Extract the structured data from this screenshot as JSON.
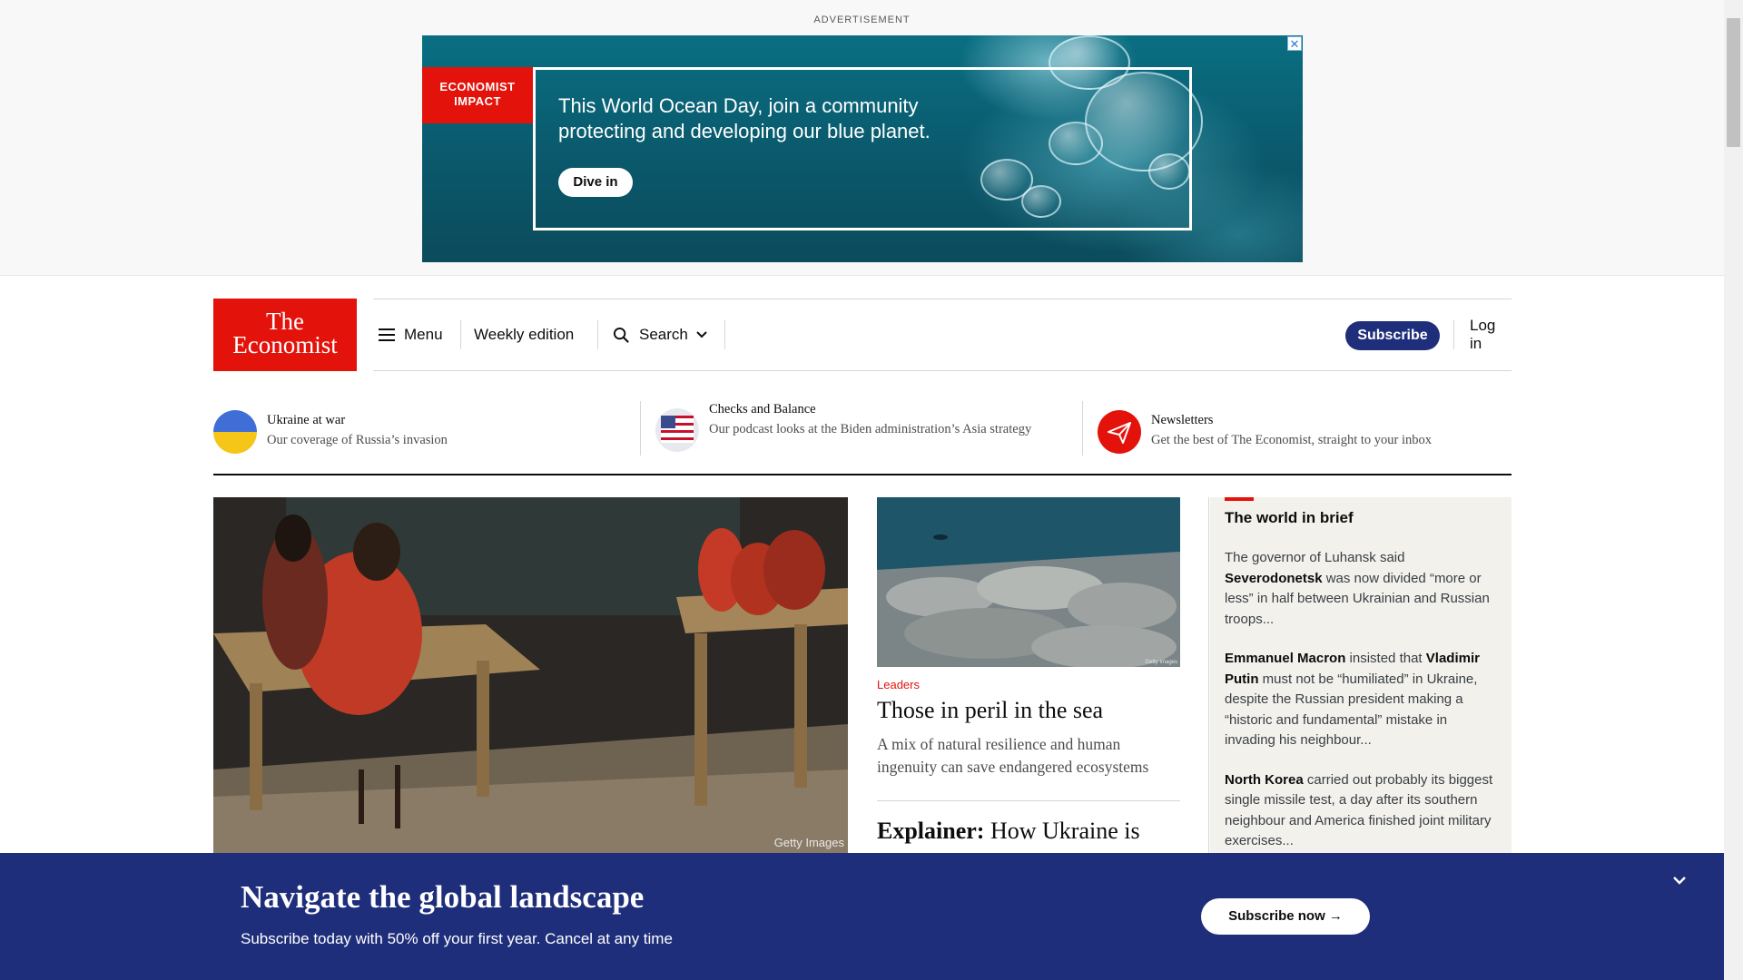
{
  "ad": {
    "label": "ADVERTISEMENT",
    "tag_line1": "ECONOMIST",
    "tag_line2": "IMPACT",
    "headline_line1": "This World Ocean Day, join a community",
    "headline_line2": "protecting and developing our blue planet.",
    "cta": "Dive in",
    "close_icon": "close-icon"
  },
  "header": {
    "logo_line1": "The",
    "logo_line2": "Economist",
    "menu": "Menu",
    "weekly": "Weekly edition",
    "search": "Search",
    "subscribe": "Subscribe",
    "login": "Log in"
  },
  "promos": [
    {
      "title": "Ukraine at war",
      "subtitle": "Our coverage of Russia’s invasion"
    },
    {
      "title": "Checks and Balance",
      "subtitle": "Our podcast looks at the Biden administration’s Asia strategy"
    },
    {
      "title": "Newsletters",
      "subtitle": "Get the best of The Economist, straight to your inbox"
    }
  ],
  "hero": {
    "credit": "Getty Images"
  },
  "lead": {
    "section": "Leaders",
    "headline": "Those in peril in the sea",
    "description": "A mix of natural resilience and human ingenuity can save endangered ecosystems",
    "image_credit": "Getty Images"
  },
  "explainer": {
    "kicker": "Explainer:",
    "headline": "How Ukraine is"
  },
  "brief": {
    "title": "The world in brief",
    "items": [
      {
        "a": "The governor of Luhansk said ",
        "b": "Severodonetsk",
        "c": " was now divided “more or less” in half between Ukrainian and Russian troops...",
        "d": "",
        "e": ""
      },
      {
        "a": "",
        "b": "Emmanuel Macron",
        "c": " insisted that ",
        "d": "Vladimir Putin",
        "e": " must not be “humiliated” in Ukraine, despite the Russian president making a “historic and fundamental” mistake in invading his neighbour..."
      },
      {
        "a": "",
        "b": "North Korea",
        "c": " carried out probably its biggest single missile test, a day after its southern neighbour and America finished joint military exercises...",
        "d": "",
        "e": ""
      }
    ]
  },
  "subscribe_banner": {
    "headline": "Navigate the global landscape",
    "text": "Subscribe today with 50% off your first year. Cancel at any time",
    "button": "Subscribe now →"
  },
  "colors": {
    "brand_red": "#e3120b",
    "navy": "#1f2e7a",
    "ukraine_blue": "#3f6fd6",
    "ukraine_yellow": "#f5c518"
  }
}
